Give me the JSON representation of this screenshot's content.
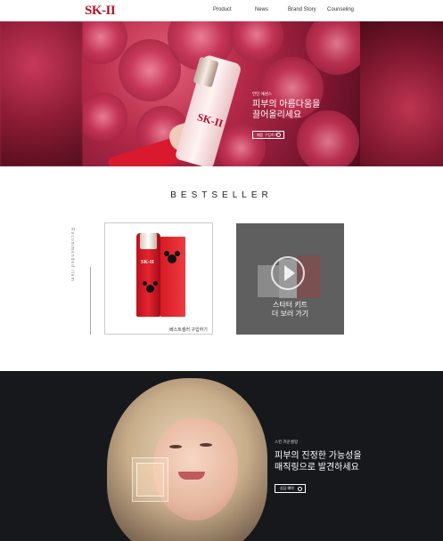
{
  "header": {
    "logo": "SK-II",
    "nav": [
      "Product",
      "News",
      "Brand Story",
      "Counseling"
    ]
  },
  "hero": {
    "sub_label": "언틴 에센스",
    "title": "피부의 아름다움을\n끌어올리세요",
    "button_label": "제품 구입하기"
  },
  "bestseller": {
    "title": "BESTSELLER",
    "side_label": "Recommended item",
    "card1_caption": "베스트셀러 구입하기",
    "card2_text": "스타터 키트\n더 보러 가기"
  },
  "banner": {
    "sub_label": "스킨 카운셀링",
    "title": "피부의 진정한 가능성을\n매직링으로 발견하세요",
    "button_label": "상담 예약"
  },
  "colors": {
    "brand": "#b4102a",
    "dark_banner": "#17181c",
    "card_gray": "#5f5f5f"
  }
}
